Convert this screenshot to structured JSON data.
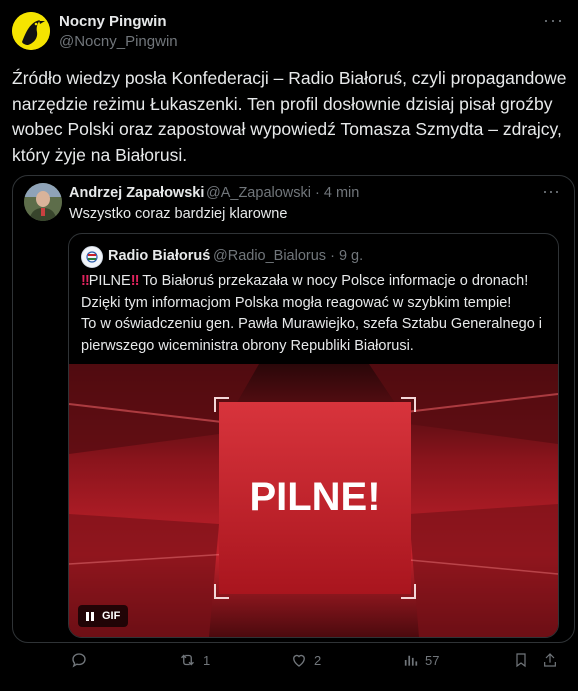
{
  "post": {
    "author": {
      "name": "Nocny Pingwin",
      "handle": "@Nocny_Pingwin",
      "avatar_color": "#f5e400"
    },
    "more_label": "···",
    "text": "Źródło wiedzy posła Konfederacji – Radio Białoruś, czyli propagandowe narzędzie reżimu Łukaszenki. Ten profil dosłownie dzisiaj pisał groźby wobec Polski oraz zapostował wypowiedź Tomasza Szmydta – zdrajcy, który żyje na Białorusi."
  },
  "quote": {
    "author": {
      "name": "Andrzej Zapałowski",
      "handle": "@A_Zapalowski",
      "time": "· 4 min"
    },
    "more_label": "···",
    "text": "Wszystko coraz bardziej klarowne",
    "nested": {
      "author": {
        "name": "Radio Białoruś",
        "handle": "@Radio_Bialorus",
        "time": "· 9 g."
      },
      "alert_emoji": "‼",
      "pilne_word": "PILNE",
      "text_after_pilne": " To Białoruś przekazała w nocy Polsce informacje o dronach!",
      "lines": [
        "Dzięki tym informacjom Polska mogła reagować w szybkim tempie!",
        "To w oświadczeniu gen. Pawła Murawiejko, szefa Sztabu Generalnego i",
        "pierwszego wiceministra obrony Republiki Białorusi."
      ],
      "media": {
        "overlay_text": "PILNE!",
        "badge": "GIF",
        "colors": {
          "panel": "#c8202a",
          "text": "#ffffff"
        }
      }
    }
  },
  "actions": {
    "replies": "",
    "reposts": "1",
    "likes": "2",
    "views": "57"
  },
  "colors": {
    "background": "#000000",
    "text_primary": "#e7e9ea",
    "text_secondary": "#71767b",
    "border": "#2f3336",
    "alert": "#e0245e"
  }
}
